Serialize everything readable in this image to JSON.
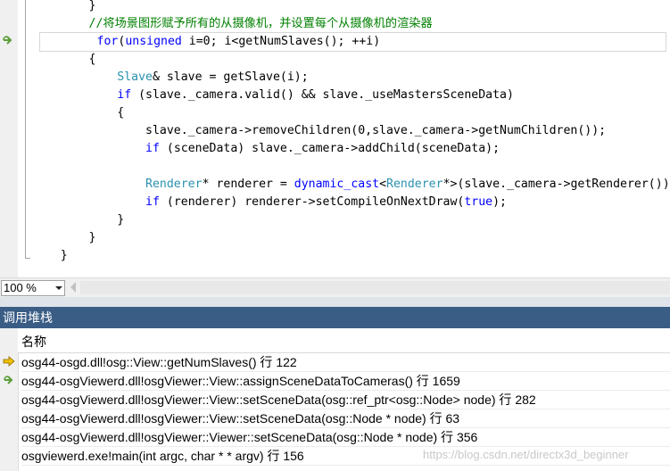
{
  "editor": {
    "lines": [
      [
        {
          "t": "        }",
          "c": "pl"
        }
      ],
      [
        {
          "t": "        //将场景图形赋予所有的从摄像机，并设置每个从摄像机的渲染器",
          "c": "cmt"
        }
      ],
      [
        {
          "t": "        ",
          "c": "pl"
        },
        {
          "t": "for",
          "c": "kw"
        },
        {
          "t": "(",
          "c": "pl"
        },
        {
          "t": "unsigned",
          "c": "kw"
        },
        {
          "t": " i=0; i<getNumSlaves(); ++i)",
          "c": "pl"
        }
      ],
      [
        {
          "t": "        {",
          "c": "pl"
        }
      ],
      [
        {
          "t": "            ",
          "c": "pl"
        },
        {
          "t": "Slave",
          "c": "type"
        },
        {
          "t": "& slave = getSlave(i);",
          "c": "pl"
        }
      ],
      [
        {
          "t": "            ",
          "c": "pl"
        },
        {
          "t": "if",
          "c": "kw"
        },
        {
          "t": " (slave._camera.valid() && slave._useMastersSceneData)",
          "c": "pl"
        }
      ],
      [
        {
          "t": "            {",
          "c": "pl"
        }
      ],
      [
        {
          "t": "                slave._camera->removeChildren(0,slave._camera->getNumChildren());",
          "c": "pl"
        }
      ],
      [
        {
          "t": "                ",
          "c": "pl"
        },
        {
          "t": "if",
          "c": "kw"
        },
        {
          "t": " (sceneData) slave._camera->addChild(sceneData);",
          "c": "pl"
        }
      ],
      [
        {
          "t": "",
          "c": "pl"
        }
      ],
      [
        {
          "t": "                ",
          "c": "pl"
        },
        {
          "t": "Renderer",
          "c": "type"
        },
        {
          "t": "* renderer = ",
          "c": "pl"
        },
        {
          "t": "dynamic_cast",
          "c": "kw"
        },
        {
          "t": "<",
          "c": "pl"
        },
        {
          "t": "Renderer",
          "c": "type"
        },
        {
          "t": "*>(slave._camera->getRenderer());",
          "c": "pl"
        }
      ],
      [
        {
          "t": "                ",
          "c": "pl"
        },
        {
          "t": "if",
          "c": "kw"
        },
        {
          "t": " (renderer) renderer->setCompileOnNextDraw(",
          "c": "pl"
        },
        {
          "t": "true",
          "c": "kw"
        },
        {
          "t": ");",
          "c": "pl"
        }
      ],
      [
        {
          "t": "            }",
          "c": "pl"
        }
      ],
      [
        {
          "t": "        }",
          "c": "pl"
        }
      ],
      [
        {
          "t": "    }",
          "c": "pl"
        }
      ]
    ],
    "current_line_index": 2
  },
  "zoom": {
    "value": "100 %"
  },
  "callstack": {
    "title": "调用堆栈",
    "column_name": "名称",
    "frames": [
      {
        "text": "osg44-osgd.dll!osg::View::getNumSlaves() 行 122",
        "icon": "current-frame-arrow-icon"
      },
      {
        "text": "osg44-osgViewerd.dll!osgViewer::View::assignSceneDataToCameras() 行 1659",
        "icon": "return-frame-arrow-icon"
      },
      {
        "text": "osg44-osgViewerd.dll!osgViewer::View::setSceneData(osg::ref_ptr<osg::Node> node) 行 282",
        "icon": ""
      },
      {
        "text": "osg44-osgViewerd.dll!osgViewer::View::setSceneData(osg::Node * node) 行 63",
        "icon": ""
      },
      {
        "text": "osg44-osgViewerd.dll!osgViewer::Viewer::setSceneData(osg::Node * node) 行 356",
        "icon": ""
      },
      {
        "text": "osgviewerd.exe!main(int argc, char * * argv) 行 156",
        "icon": ""
      }
    ],
    "watermark": "https://blog.csdn.net/directx3d_beginner"
  },
  "colors": {
    "keyword": "#0000ff",
    "type": "#2b91af",
    "comment": "#008000",
    "panel_header": "#3a5d85",
    "current_arrow": "#f0c000",
    "return_arrow": "#5a9e3a"
  }
}
